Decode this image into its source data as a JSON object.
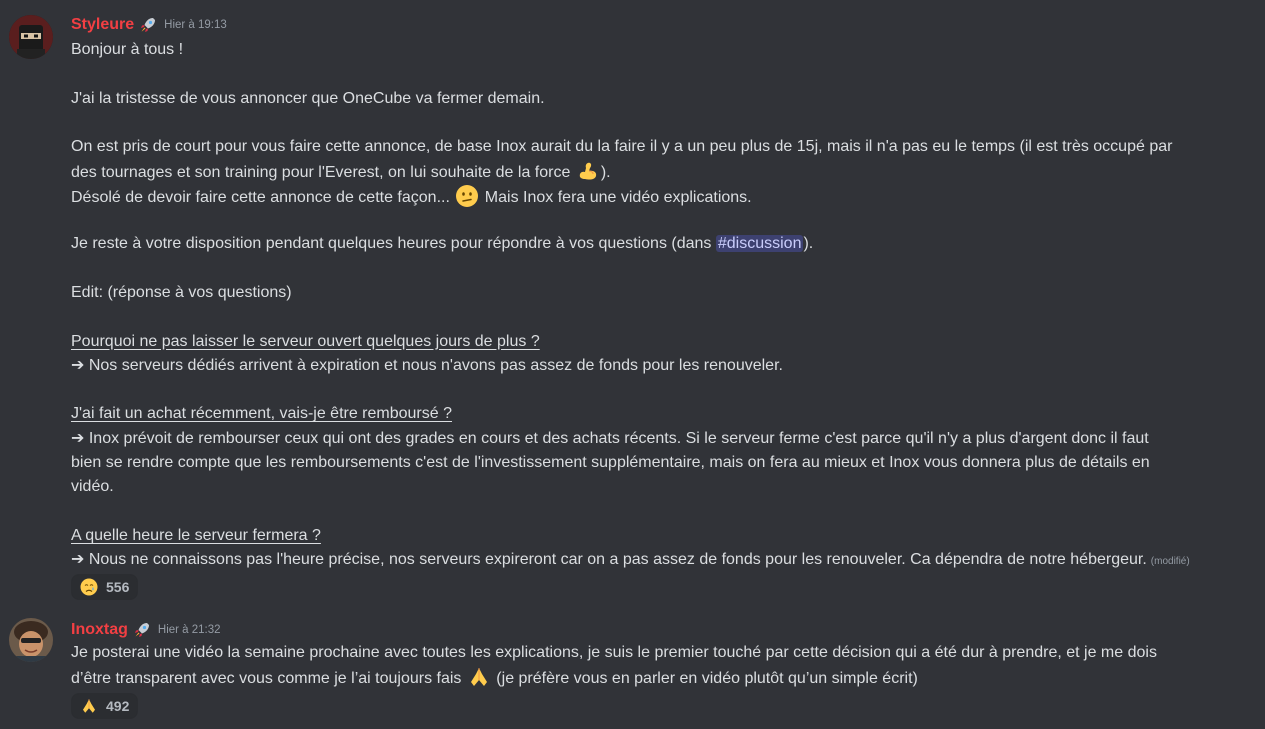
{
  "messages": [
    {
      "username": "Styleure",
      "role_icon": "rocket-icon",
      "timestamp": "Hier à 19:13",
      "lines": {
        "l1": "Bonjour à tous !",
        "l2": "J'ai la tristesse de vous annoncer que OneCube va fermer demain.",
        "l3": "On est pris de court pour vous faire cette annonce, de base Inox aurait du la faire il y a un peu plus de 15j, mais il n'a pas eu le temps (il est très occupé par",
        "l4a": "des tournages et son training pour l'Everest, on lui souhaite de la force ",
        "l4b": ").",
        "l5a": "Désolé de devoir faire cette annonce de cette façon... ",
        "l5b": " Mais Inox fera une vidéo explications.",
        "l6a": "Je reste à votre disposition pendant quelques heures pour répondre à vos questions (dans ",
        "l6_channel": "#discussion",
        "l6b": ").",
        "l7": "Edit: (réponse à vos questions)",
        "q1": "Pourquoi ne pas laisser le serveur ouvert quelques jours de plus ?",
        "a1": "➔ Nos serveurs dédiés arrivent à expiration et nous n'avons pas assez de fonds pour les renouveler.",
        "q2": "J'ai fait un achat récemment, vais-je être remboursé ?",
        "a2a": "➔ Inox prévoit de rembourser ceux qui ont des grades en cours et des achats récents. Si le serveur ferme c'est parce qu'il n'y a plus d'argent donc il faut",
        "a2b": "bien se rendre compte que les remboursements c'est de l'investissement supplémentaire, mais on fera au mieux et Inox vous donnera plus de détails en",
        "a2c": "vidéo.",
        "q3": "A quelle heure le serveur fermera ?",
        "a3": "➔ Nous ne connaissons pas l'heure précise, nos serveurs expireront car on a pas assez de fonds pour les renouveler. Ca dépendra de notre hébergeur.",
        "edited": "(modifié)"
      },
      "inline_emojis": [
        "flexed-biceps-emoji",
        "confused-face-emoji"
      ],
      "reaction": {
        "emoji": "crying-face-emoji",
        "count": "556"
      }
    },
    {
      "username": "Inoxtag",
      "role_icon": "rocket-icon",
      "timestamp": "Hier à 21:32",
      "lines": {
        "l1": "Je posterai une vidéo la semaine prochaine avec toutes les explications, je suis le premier touché par cette décision qui a été dur à prendre, et je me dois",
        "l2a": "d’être transparent avec vous comme je l’ai toujours fais ",
        "l2b": " (je préfère vous en parler en vidéo plutôt qu’un simple écrit)"
      },
      "inline_emojis": [
        "folded-hands-emoji"
      ],
      "reaction": {
        "emoji": "folded-hands-emoji",
        "count": "492"
      }
    }
  ],
  "colors": {
    "background": "#313338",
    "username": "#f23f43",
    "text": "#dbdee1",
    "timestamp": "#949ba4",
    "mention_bg": "#3c4270",
    "reaction_bg": "#2b2d31"
  }
}
